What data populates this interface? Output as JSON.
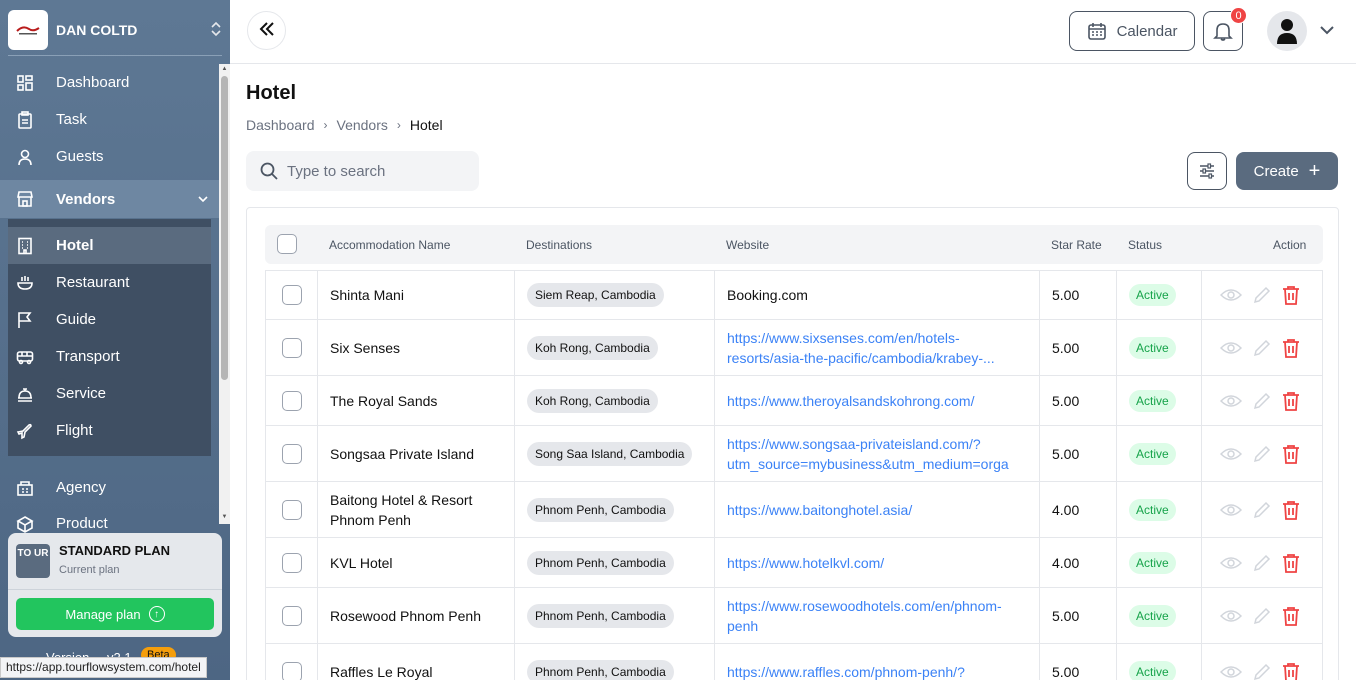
{
  "company": {
    "name": "DAN COLTD"
  },
  "sidebar": {
    "items": [
      {
        "label": "Dashboard"
      },
      {
        "label": "Task"
      },
      {
        "label": "Guests"
      },
      {
        "label": "Vendors"
      },
      {
        "label": "Agency"
      },
      {
        "label": "Product"
      }
    ],
    "vendor_sub": [
      {
        "label": "Hotel"
      },
      {
        "label": "Restaurant"
      },
      {
        "label": "Guide"
      },
      {
        "label": "Transport"
      },
      {
        "label": "Service"
      },
      {
        "label": "Flight"
      }
    ]
  },
  "plan": {
    "icon_text": "TO UR",
    "title": "STANDARD PLAN",
    "subtitle": "Current plan",
    "manage_label": "Manage plan",
    "version_label": "Version",
    "version": "v2.1",
    "beta_label": "Beta"
  },
  "status_url": "https://app.tourflowsystem.com/hotel",
  "topbar": {
    "calendar_label": "Calendar",
    "notification_count": "0"
  },
  "page": {
    "title": "Hotel",
    "breadcrumb": [
      "Dashboard",
      "Vendors",
      "Hotel"
    ],
    "search_placeholder": "Type to search",
    "create_label": "Create"
  },
  "table": {
    "headers": [
      "Accommodation Name",
      "Destinations",
      "Website",
      "Star Rate",
      "Status",
      "Action"
    ],
    "rows": [
      {
        "name": "Shinta Mani",
        "destination": "Siem Reap, Cambodia",
        "website": "Booking.com",
        "is_link": false,
        "star": "5.00",
        "status": "Active"
      },
      {
        "name": "Six Senses",
        "destination": "Koh Rong, Cambodia",
        "website": "https://www.sixsenses.com/en/hotels-resorts/asia-the-pacific/cambodia/krabey-...",
        "is_link": true,
        "star": "5.00",
        "status": "Active"
      },
      {
        "name": "The Royal Sands",
        "destination": "Koh Rong, Cambodia",
        "website": "https://www.theroyalsandskohrong.com/",
        "is_link": true,
        "star": "5.00",
        "status": "Active"
      },
      {
        "name": "Songsaa Private Island",
        "destination": "Song Saa Island, Cambodia",
        "website": "https://www.songsaa-privateisland.com/?utm_source=mybusiness&utm_medium=orga",
        "is_link": true,
        "star": "5.00",
        "status": "Active"
      },
      {
        "name": "Baitong Hotel & Resort Phnom Penh",
        "destination": "Phnom Penh, Cambodia",
        "website": "https://www.baitonghotel.asia/",
        "is_link": true,
        "star": "4.00",
        "status": "Active"
      },
      {
        "name": "KVL Hotel",
        "destination": "Phnom Penh, Cambodia",
        "website": "https://www.hotelkvl.com/",
        "is_link": true,
        "star": "4.00",
        "status": "Active"
      },
      {
        "name": "Rosewood Phnom Penh",
        "destination": "Phnom Penh, Cambodia",
        "website": "https://www.rosewoodhotels.com/en/phnom-penh",
        "is_link": true,
        "star": "5.00",
        "status": "Active"
      },
      {
        "name": "Raffles Le Royal",
        "destination": "Phnom Penh, Cambodia",
        "website": "https://www.raffles.com/phnom-penh/?",
        "is_link": true,
        "star": "5.00",
        "status": "Active"
      }
    ]
  },
  "colors": {
    "sidebar": "#5e7894",
    "primary": "#5a6b7f",
    "success": "#22c55e",
    "danger": "#ef4444",
    "link": "#3b82f6"
  }
}
